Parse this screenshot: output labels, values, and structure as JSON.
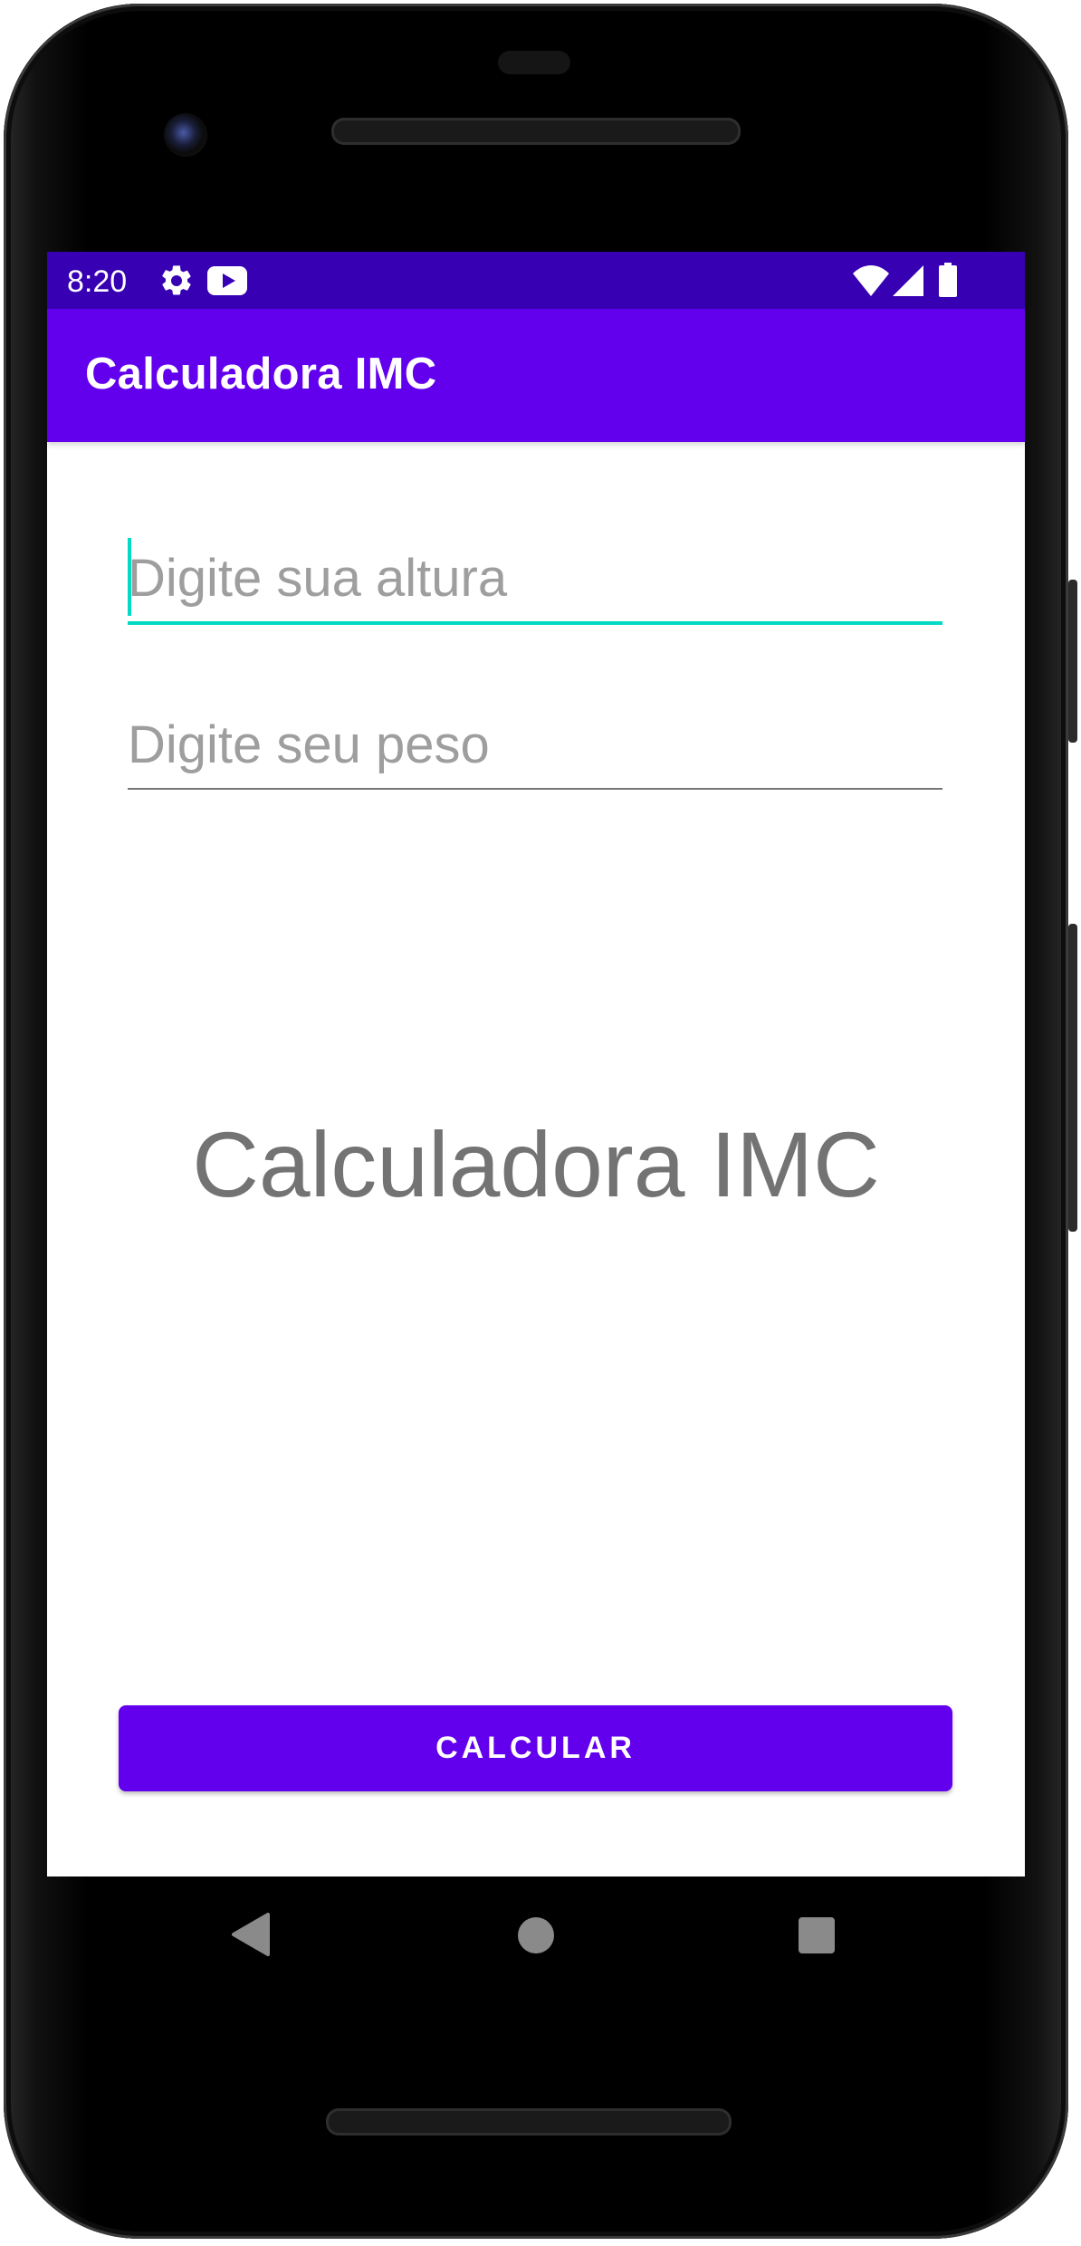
{
  "status_bar": {
    "time": "8:20",
    "left_icons": [
      "gear-icon",
      "youtube-icon"
    ],
    "right_icons": [
      "wifi-icon",
      "signal-icon",
      "battery-icon"
    ]
  },
  "app_bar": {
    "title": "Calculadora IMC"
  },
  "form": {
    "height_placeholder": "Digite sua altura",
    "height_value": "",
    "weight_placeholder": "Digite seu peso",
    "weight_value": ""
  },
  "result": {
    "text": "Calculadora IMC"
  },
  "actions": {
    "calculate_label": "CALCULAR"
  },
  "nav_bar": {
    "buttons": [
      "back-icon",
      "home-icon",
      "recents-icon"
    ]
  },
  "colors": {
    "primary": "#6200ee",
    "primary_dark": "#3700b3",
    "accent": "#03dac5",
    "result_text": "#737373",
    "hint_text": "#9e9e9e"
  }
}
